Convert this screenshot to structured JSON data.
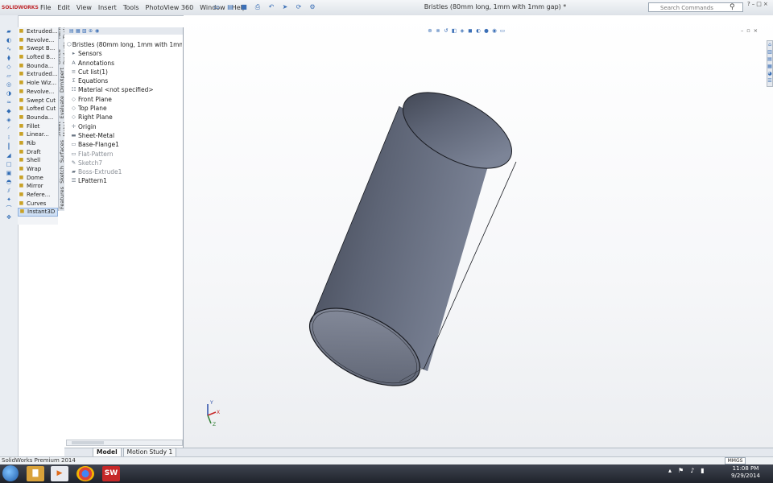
{
  "app": {
    "logo_text": "SOLIDWORKS",
    "doc_title": "Bristles (80mm long, 1mm with 1mm gap) *",
    "menu": [
      "File",
      "Edit",
      "View",
      "Insert",
      "Tools",
      "PhotoView 360",
      "Window",
      "Help"
    ],
    "search_placeholder": "Search Commands",
    "window_controls": [
      "?",
      "–",
      "□",
      "×"
    ]
  },
  "features_list": [
    {
      "label": "Extruded..."
    },
    {
      "label": "Revolve..."
    },
    {
      "label": "Swept B..."
    },
    {
      "label": "Lofted B..."
    },
    {
      "label": "Bounda..."
    },
    {
      "label": "Extruded..."
    },
    {
      "label": "Hole Wiz..."
    },
    {
      "label": "Revolve..."
    },
    {
      "label": "Swept Cut"
    },
    {
      "label": "Lofted Cut"
    },
    {
      "label": "Bounda..."
    },
    {
      "label": "Fillet"
    },
    {
      "label": "Linear..."
    },
    {
      "label": "Rib"
    },
    {
      "label": "Draft"
    },
    {
      "label": "Shell"
    },
    {
      "label": "Wrap"
    },
    {
      "label": "Dome"
    },
    {
      "label": "Mirror"
    },
    {
      "label": "Refere..."
    },
    {
      "label": "Curves"
    },
    {
      "label": "Instant3D"
    }
  ],
  "vertical_tabs": [
    "Features",
    "Sketch",
    "Surfaces",
    "Sheet Metal",
    "Evaluate",
    "DimXpert",
    "Office Products",
    "Render Tools"
  ],
  "tree": {
    "root": "Bristles (80mm long, 1mm with 1mm g",
    "items": [
      {
        "label": "Sensors",
        "icon": "folder-icon"
      },
      {
        "label": "Annotations",
        "icon": "annotation-icon"
      },
      {
        "label": "Cut list(1)",
        "icon": "cutlist-icon"
      },
      {
        "label": "Equations",
        "icon": "equation-icon"
      },
      {
        "label": "Material <not specified>",
        "icon": "material-icon"
      },
      {
        "label": "Front Plane",
        "icon": "plane-icon"
      },
      {
        "label": "Top Plane",
        "icon": "plane-icon"
      },
      {
        "label": "Right Plane",
        "icon": "plane-icon"
      },
      {
        "label": "Origin",
        "icon": "origin-icon"
      },
      {
        "label": "Sheet-Metal",
        "icon": "sheetmetal-icon"
      },
      {
        "label": "Base-Flange1",
        "icon": "flange-icon"
      },
      {
        "label": "Flat-Pattern",
        "icon": "flatpattern-icon",
        "greyed": true
      },
      {
        "label": "Sketch7",
        "icon": "sketch-icon",
        "greyed": true
      },
      {
        "label": "Boss-Extrude1",
        "icon": "extrude-icon",
        "greyed": true
      },
      {
        "label": "LPattern1",
        "icon": "pattern-icon"
      }
    ]
  },
  "bottom_tabs": [
    "Model",
    "Motion Study 1"
  ],
  "status": {
    "text": "SolidWorks Premium 2014",
    "units": "MMGS"
  },
  "taskbar": {
    "time": "11:08 PM",
    "date": "9/29/2014"
  },
  "colors": {
    "cylinder_body": "#565d6e",
    "cylinder_edge": "#1a1c22",
    "accent": "#3b6fb6"
  }
}
